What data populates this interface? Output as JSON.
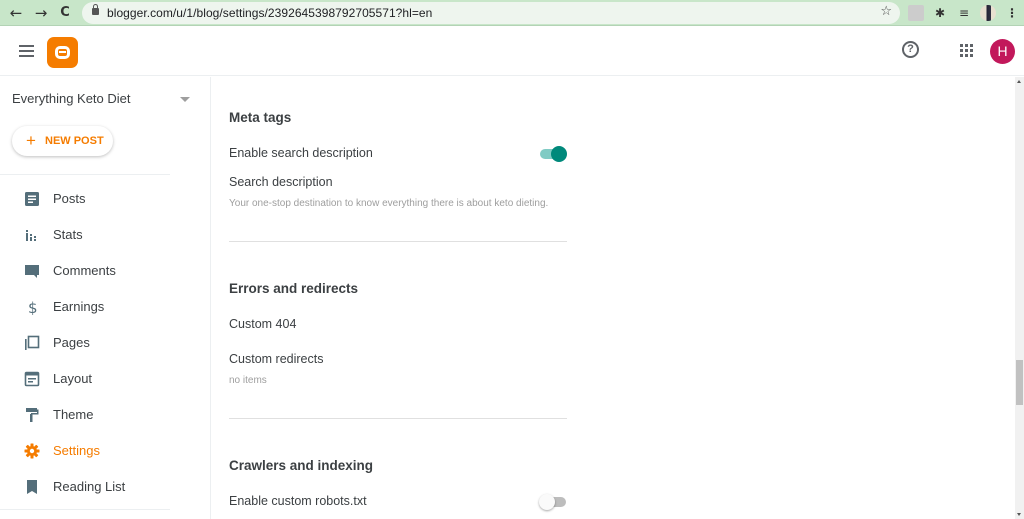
{
  "browser": {
    "url": "blogger.com/u/1/blog/settings/2392645398792705571?hl=en",
    "back_icon": "arrow-left-icon",
    "forward_icon": "arrow-right-icon",
    "reload_icon": "reload-icon",
    "bookmark_icon": "star-icon",
    "glyphs": {
      "back": "←",
      "forward": "→",
      "reload": "C",
      "star": "☆",
      "menu": "⋮",
      "puzzle": "✱",
      "media": "≡"
    }
  },
  "header": {
    "avatar_letter": "H",
    "avatar_color": "#c2185b",
    "brand_color": "#f57c00",
    "help_glyph": "?"
  },
  "sidebar": {
    "blog_name": "Everything Keto Diet",
    "new_post": {
      "plus": "+",
      "label": "NEW POST"
    },
    "items": [
      {
        "label": "Posts",
        "icon": "posts-icon",
        "active": false
      },
      {
        "label": "Stats",
        "icon": "stats-icon",
        "active": false
      },
      {
        "label": "Comments",
        "icon": "comments-icon",
        "active": false
      },
      {
        "label": "Earnings",
        "icon": "dollar-icon",
        "active": false
      },
      {
        "label": "Pages",
        "icon": "pages-icon",
        "active": false
      },
      {
        "label": "Layout",
        "icon": "layout-icon",
        "active": false
      },
      {
        "label": "Theme",
        "icon": "paint-roller-icon",
        "active": false
      },
      {
        "label": "Settings",
        "icon": "gear-icon",
        "active": true
      },
      {
        "label": "Reading List",
        "icon": "bookmark-icon",
        "active": false
      }
    ]
  },
  "main": {
    "meta_tags": {
      "title": "Meta tags",
      "enable_search_description": {
        "label": "Enable search description",
        "enabled": true
      },
      "search_description": {
        "label": "Search description",
        "value": "Your one-stop destination to know everything there is about keto dieting."
      }
    },
    "errors_redirects": {
      "title": "Errors and redirects",
      "custom_404": {
        "label": "Custom 404"
      },
      "custom_redirects": {
        "label": "Custom redirects",
        "value": "no items"
      }
    },
    "crawlers_indexing": {
      "title": "Crawlers and indexing",
      "enable_custom_robots": {
        "label": "Enable custom robots.txt",
        "enabled": false
      }
    }
  },
  "colors": {
    "accent": "#f57c00",
    "toggle_on": "#00897b",
    "toggle_on_track": "#80cbc4",
    "chrome_bar": "#c8e6c9"
  }
}
